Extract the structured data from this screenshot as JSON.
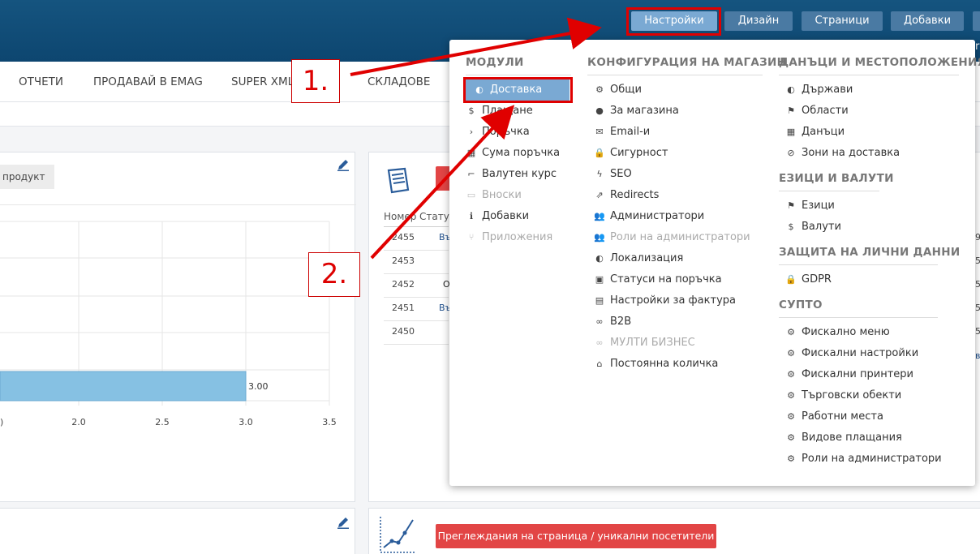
{
  "top_buttons": [
    "Настройки",
    "Дизайн",
    "Страници",
    "Добавки"
  ],
  "header_cutoff_char": "r",
  "nav": [
    "ОТЧЕТИ",
    "ПРОДАВАЙ В EMAG",
    "SUPER XML",
    "СКЛАДОВЕ"
  ],
  "left_panel": {
    "product_label": "продукт",
    "bar_value_label": "3.00",
    "x_ticks": [
      "2.0",
      "2.5",
      "3.0",
      "3.5"
    ],
    "x_tick_partial": ")"
  },
  "orders_panel": {
    "headers": [
      "Номер",
      "Статус"
    ],
    "numbers": [
      "2455",
      "2453",
      "2452",
      "2451",
      "2450"
    ],
    "status_fragments": [
      "Въ",
      "",
      "О",
      "Въ",
      ""
    ],
    "right_edge_fragments": [
      "9",
      "5",
      "5",
      "5",
      "5",
      "в"
    ]
  },
  "bottom_panel": {
    "views_button": "Преглеждания на страница / уникални посетители"
  },
  "chart_data": {
    "type": "bar",
    "categories": [
      ""
    ],
    "values": [
      3.0
    ],
    "data_labels": [
      "3.00"
    ],
    "xlim_visible": [
      1.5,
      3.5
    ],
    "x_ticks": [
      2.0,
      2.5,
      3.0,
      3.5
    ],
    "orientation": "horizontal",
    "bar_color": "#86c1e3",
    "grid": true
  },
  "menu": {
    "modules": {
      "title": "МОДУЛИ",
      "items": [
        {
          "label": "Доставка",
          "icon": "globe-icon",
          "glyph": "◐",
          "state": "selected"
        },
        {
          "label": "Плащане",
          "icon": "dollar-icon",
          "glyph": "$",
          "state": "normal"
        },
        {
          "label": "Поръчка",
          "icon": "chevron-icon",
          "glyph": "›",
          "state": "normal"
        },
        {
          "label": "Сума поръчка",
          "icon": "calculator-icon",
          "glyph": "▦",
          "state": "normal"
        },
        {
          "label": "Валутен курс",
          "icon": "line-chart-icon",
          "glyph": "⌐",
          "state": "normal"
        },
        {
          "label": "Вноски",
          "icon": "credit-card-icon",
          "glyph": "▭",
          "state": "disabled"
        },
        {
          "label": "Добавки",
          "icon": "info-icon",
          "glyph": "ℹ",
          "state": "normal"
        },
        {
          "label": "Приложения",
          "icon": "branch-icon",
          "glyph": "⑂",
          "state": "disabled"
        }
      ]
    },
    "store_config": {
      "title": "КОНФИГУРАЦИЯ НА МАГАЗИН",
      "items": [
        {
          "label": "Общи",
          "icon": "gear-icon",
          "glyph": "⚙",
          "state": "normal"
        },
        {
          "label": "За магазина",
          "icon": "user-icon",
          "glyph": "●",
          "state": "normal"
        },
        {
          "label": "Email-и",
          "icon": "envelope-icon",
          "glyph": "✉",
          "state": "normal"
        },
        {
          "label": "Сигурност",
          "icon": "lock-icon",
          "glyph": "🔒",
          "state": "normal"
        },
        {
          "label": "SEO",
          "icon": "bolt-icon",
          "glyph": "ϟ",
          "state": "normal"
        },
        {
          "label": "Redirects",
          "icon": "external-link-icon",
          "glyph": "⇗",
          "state": "normal"
        },
        {
          "label": "Администратори",
          "icon": "users-icon",
          "glyph": "👥",
          "state": "normal"
        },
        {
          "label": "Роли на администратори",
          "icon": "users-icon",
          "glyph": "👥",
          "state": "disabled"
        },
        {
          "label": "Локализация",
          "icon": "globe-icon",
          "glyph": "◐",
          "state": "normal"
        },
        {
          "label": "Статуси на поръчка",
          "icon": "briefcase-icon",
          "glyph": "▣",
          "state": "normal"
        },
        {
          "label": "Настройки за фактура",
          "icon": "file-icon",
          "glyph": "▤",
          "state": "normal"
        },
        {
          "label": "B2B",
          "icon": "link-icon",
          "glyph": "∞",
          "state": "normal"
        },
        {
          "label": "МУЛТИ БИЗНЕС",
          "icon": "link-icon",
          "glyph": "∞",
          "state": "disabled"
        },
        {
          "label": "Постоянна количка",
          "icon": "home-icon",
          "glyph": "⌂",
          "state": "normal"
        }
      ]
    },
    "taxes_locations": {
      "title": "ДАНЪЦИ И МЕСТОПОЛОЖЕНИЯ",
      "items": [
        {
          "label": "Държави",
          "icon": "globe-icon",
          "glyph": "◐",
          "state": "normal"
        },
        {
          "label": "Области",
          "icon": "flag-icon",
          "glyph": "⚑",
          "state": "normal"
        },
        {
          "label": "Данъци",
          "icon": "calculator-icon",
          "glyph": "▦",
          "state": "normal"
        },
        {
          "label": "Зони на доставка",
          "icon": "compass-icon",
          "glyph": "⊘",
          "state": "normal"
        }
      ]
    },
    "languages_currencies": {
      "title": "ЕЗИЦИ И ВАЛУТИ",
      "items": [
        {
          "label": "Езици",
          "icon": "flag-icon",
          "glyph": "⚑",
          "state": "normal"
        },
        {
          "label": "Валути",
          "icon": "dollar-icon",
          "glyph": "$",
          "state": "normal"
        }
      ]
    },
    "privacy": {
      "title": "ЗАЩИТА НА ЛИЧНИ ДАННИ",
      "items": [
        {
          "label": "GDPR",
          "icon": "lock-icon",
          "glyph": "🔒",
          "state": "normal"
        }
      ]
    },
    "supto": {
      "title": "СУПТО",
      "items": [
        {
          "label": "Фискално меню",
          "icon": "gear-icon",
          "glyph": "⚙",
          "state": "normal"
        },
        {
          "label": "Фискални настройки",
          "icon": "gear-icon",
          "glyph": "⚙",
          "state": "normal"
        },
        {
          "label": "Фискални принтери",
          "icon": "gear-icon",
          "glyph": "⚙",
          "state": "normal"
        },
        {
          "label": "Търговски обекти",
          "icon": "gear-icon",
          "glyph": "⚙",
          "state": "normal"
        },
        {
          "label": "Работни места",
          "icon": "gear-icon",
          "glyph": "⚙",
          "state": "normal"
        },
        {
          "label": "Видове плащания",
          "icon": "gear-icon",
          "glyph": "⚙",
          "state": "normal"
        },
        {
          "label": "Роли на администратори",
          "icon": "gear-icon",
          "glyph": "⚙",
          "state": "normal"
        }
      ]
    }
  },
  "annotations": {
    "step1": "1.",
    "step2": "2.",
    "color": "#e00000"
  }
}
